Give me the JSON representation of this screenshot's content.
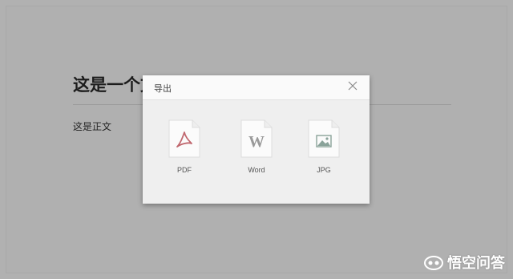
{
  "document": {
    "title": "这是一个文章标题",
    "body": "这是正文"
  },
  "dialog": {
    "title": "导出",
    "close_icon": "close-icon",
    "options": [
      {
        "label": "PDF",
        "icon": "pdf-file-icon",
        "color": "#c0676e"
      },
      {
        "label": "Word",
        "icon": "word-file-icon",
        "color": "#9a9a9a"
      },
      {
        "label": "JPG",
        "icon": "image-file-icon",
        "color": "#8aa39a"
      }
    ]
  },
  "watermark": {
    "text": "悟空问答"
  }
}
